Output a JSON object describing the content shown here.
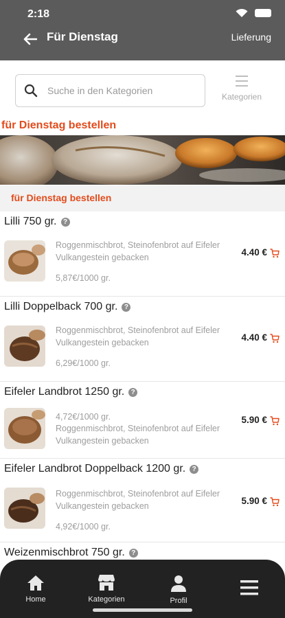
{
  "status_bar": {
    "time": "2:18"
  },
  "header": {
    "title": "Für Dienstag",
    "delivery_label": "Lieferung"
  },
  "search": {
    "placeholder": "Suche in den Kategorien",
    "categories_label": "Kategorien"
  },
  "section_title": "für Dienstag bestellen",
  "sub_header": "für Dienstag bestellen",
  "colors": {
    "header_bg": "#5b5b5b",
    "accent": "#e24b1c",
    "bottom_nav_bg": "#222222"
  },
  "products": [
    {
      "name": "Lilli 750 gr.",
      "desc_line1": "Roggenmischbrot, Steinofenbrot auf Eifeler",
      "desc_line2": "Vulkangestein gebacken",
      "unit_price": "5,87€/1000 gr.",
      "price": "4.40 €"
    },
    {
      "name": "Lilli Doppelback 700 gr.",
      "desc_line1": "Roggenmischbrot, Steinofenbrot auf Eifeler",
      "desc_line2": "Vulkangestein gebacken",
      "unit_price": "6,29€/1000 gr.",
      "price": "4.40 €"
    },
    {
      "name": "Eifeler Landbrot 1250 gr.",
      "unit_price": "4,72€/1000 gr.",
      "desc_line1": "Roggenmischbrot, Steinofenbrot auf Eifeler",
      "desc_line2": "Vulkangestein gebacken",
      "price": "5.90 €"
    },
    {
      "name": "Eifeler Landbrot Doppelback 1200 gr.",
      "desc_line1": "Roggenmischbrot, Steinofenbrot auf Eifeler",
      "desc_line2": "Vulkangestein gebacken",
      "unit_price": "4,92€/1000 gr.",
      "price": "5.90 €"
    },
    {
      "name": "Weizenmischbrot 750 gr."
    }
  ],
  "bottom_nav": [
    {
      "label": "Home",
      "icon": "home-icon"
    },
    {
      "label": "Kategorien",
      "icon": "store-icon"
    },
    {
      "label": "Profil",
      "icon": "person-icon"
    },
    {
      "label": "",
      "icon": "menu-icon"
    }
  ]
}
